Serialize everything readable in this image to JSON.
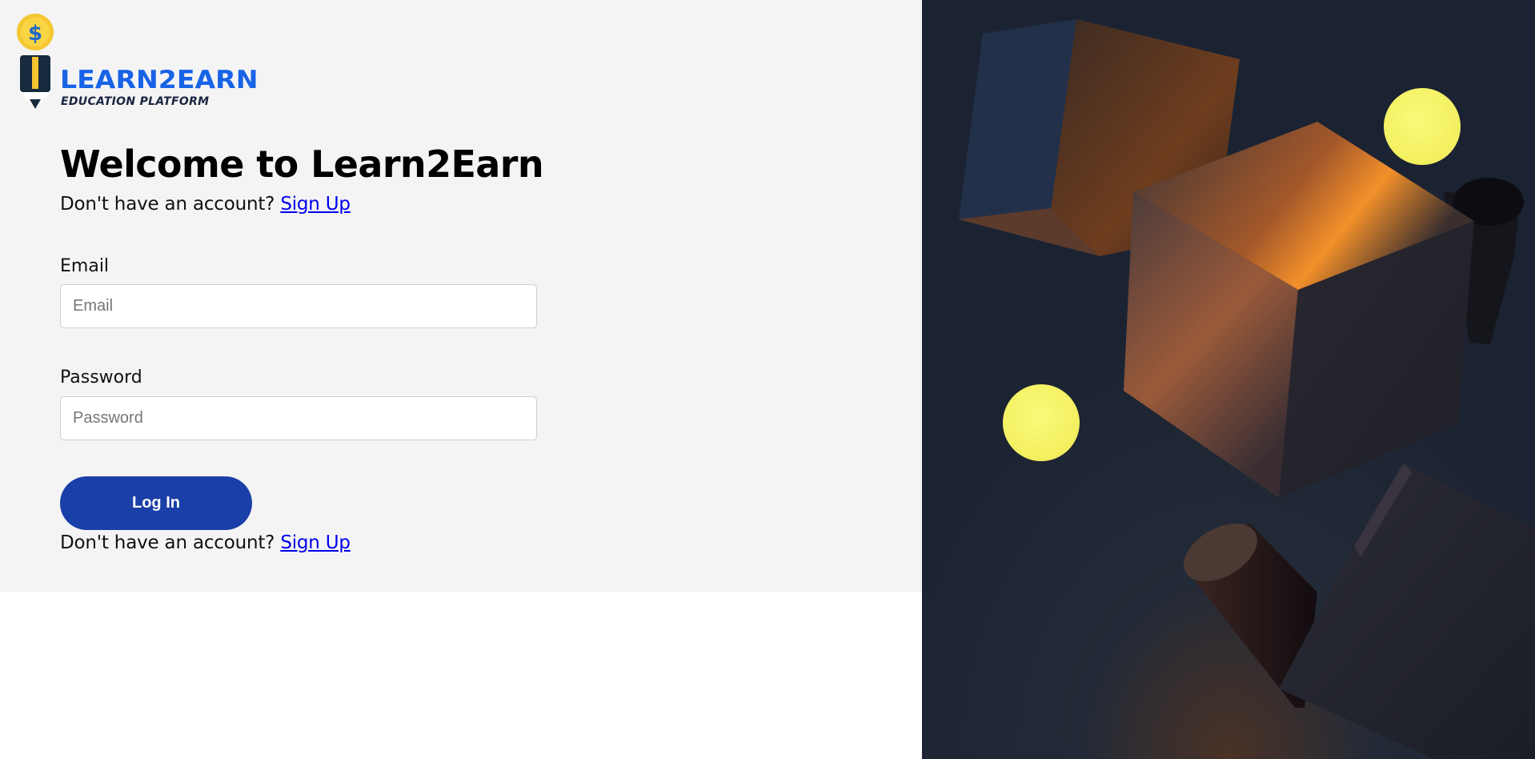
{
  "brand": {
    "name": "LEARN2EARN",
    "tagline": "EDUCATION PLATFORM",
    "coin_symbol": "$"
  },
  "login": {
    "heading": "Welcome to Learn2Earn",
    "account_prompt": "Don't have an account?",
    "signup_link": "Sign Up",
    "email_label": "Email",
    "email_placeholder": "Email",
    "password_label": "Password",
    "password_placeholder": "Password",
    "login_button": "Log In"
  },
  "colors": {
    "brand_blue": "#1863e6",
    "button_blue": "#1a3fa8",
    "link": "#0000ee",
    "panel_background": "#f4f4f4",
    "art_background": "#1b2332",
    "coin_yellow": "#f7f26e"
  }
}
